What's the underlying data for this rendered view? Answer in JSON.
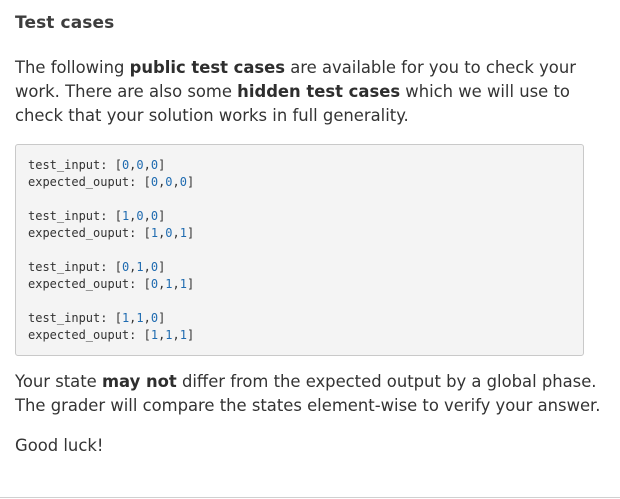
{
  "heading": "Test cases",
  "intro": {
    "t1": "The following ",
    "b1": "public test cases",
    "t2": " are available for you to check your work. There are also some ",
    "b2": "hidden test cases",
    "t3": " which we will use to check that your solution works in full generality."
  },
  "code": {
    "input_key": "test_input: ",
    "output_key": "expected_ouput: ",
    "cases": [
      {
        "input": [
          "0",
          "0",
          "0"
        ],
        "output": [
          "0",
          "0",
          "0"
        ]
      },
      {
        "input": [
          "1",
          "0",
          "0"
        ],
        "output": [
          "1",
          "0",
          "1"
        ]
      },
      {
        "input": [
          "0",
          "1",
          "0"
        ],
        "output": [
          "0",
          "1",
          "1"
        ]
      },
      {
        "input": [
          "1",
          "1",
          "0"
        ],
        "output": [
          "1",
          "1",
          "1"
        ]
      }
    ]
  },
  "note": {
    "t1": "Your state ",
    "b1": "may not",
    "t2": " differ from the expected output by a global phase. The grader will compare the states element-wise to verify your answer."
  },
  "closing": "Good luck!"
}
